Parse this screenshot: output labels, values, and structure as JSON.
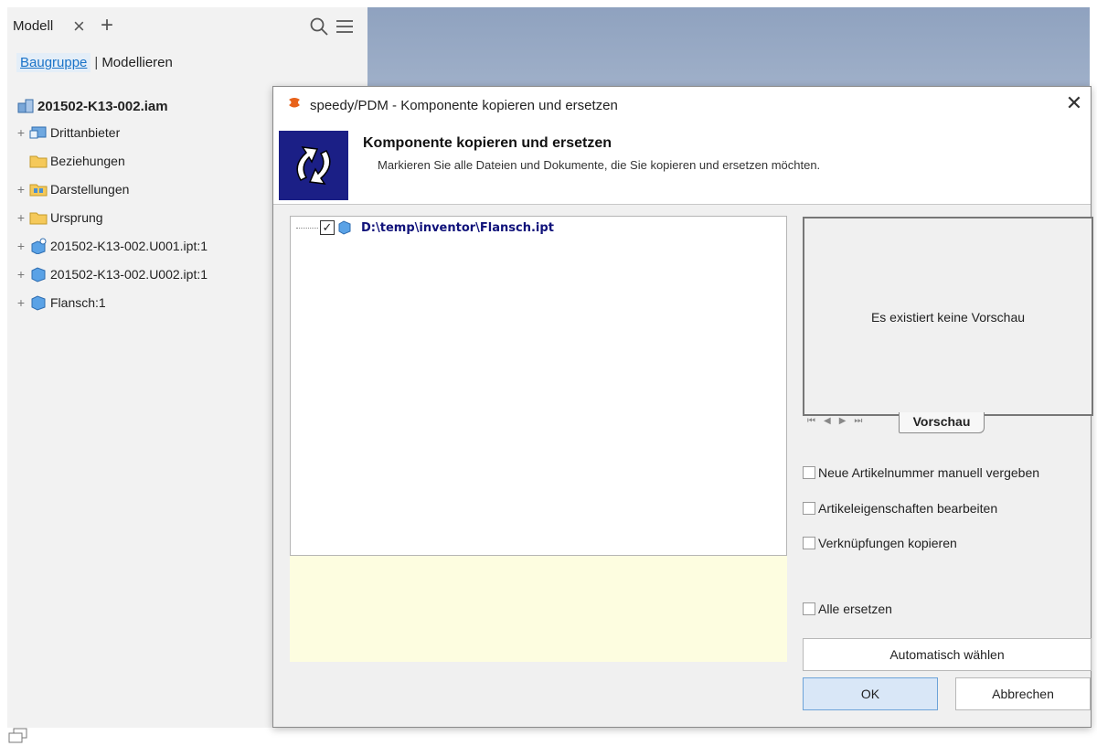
{
  "browser_panel": {
    "tab_label": "Modell",
    "subtabs": [
      "Baugruppe",
      "Modellieren"
    ],
    "tree": [
      {
        "label": "201502-K13-002.iam",
        "icon": "assembly-icon",
        "expander": "",
        "root": true
      },
      {
        "label": "Drittanbieter",
        "icon": "third-party-icon",
        "expander": "+"
      },
      {
        "label": "Beziehungen",
        "icon": "folder-icon",
        "expander": ""
      },
      {
        "label": "Darstellungen",
        "icon": "representations-folder-icon",
        "expander": "+"
      },
      {
        "label": "Ursprung",
        "icon": "folder-icon",
        "expander": "+"
      },
      {
        "label": "201502-K13-002.U001.ipt:1",
        "icon": "part-link-icon",
        "expander": "+"
      },
      {
        "label": "201502-K13-002.U002.ipt:1",
        "icon": "part-icon",
        "expander": "+"
      },
      {
        "label": "Flansch:1",
        "icon": "part-icon",
        "expander": "+"
      }
    ]
  },
  "dialog": {
    "window_title": "speedy/PDM - Komponente kopieren und ersetzen",
    "banner_title": "Komponente kopieren und ersetzen",
    "banner_subtitle": "Markieren Sie alle Dateien und Dokumente, die Sie kopieren und ersetzen möchten.",
    "file_entry": {
      "path": "D:\\temp\\inventor\\Flansch.ipt",
      "checked": true
    },
    "preview_message": "Es existiert keine Vorschau",
    "preview_tab": "Vorschau",
    "options": [
      {
        "label": "Neue Artikelnummer manuell vergeben",
        "checked": false
      },
      {
        "label": "Artikeleigenschaften bearbeiten",
        "checked": false
      },
      {
        "label": "Verknüpfungen kopieren",
        "checked": false
      },
      {
        "label": "Alle ersetzen",
        "checked": false
      }
    ],
    "auto_select_label": "Automatisch wählen",
    "ok_label": "OK",
    "cancel_label": "Abbrechen"
  },
  "colors": {
    "accent": "#1a73c8",
    "file_path": "#10127a",
    "banner_icon_bg": "#1b1f86",
    "info_box": "#fdfde0",
    "primary_button": "#d9e7f7"
  }
}
